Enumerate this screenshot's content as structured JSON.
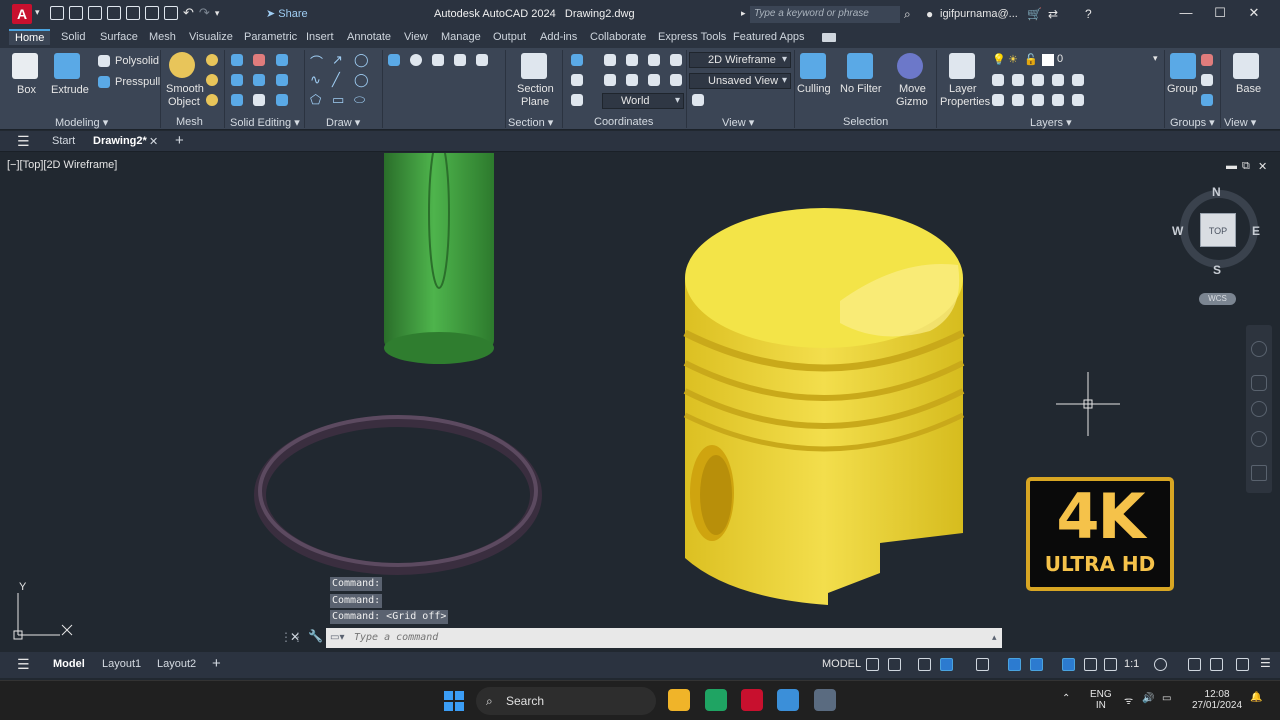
{
  "window": {
    "title": "Autodesk AutoCAD 2024",
    "file": "Drawing2.dwg",
    "share_label": "Share",
    "search_placeholder": "Type a keyword or phrase",
    "user": "igifpurnama@..."
  },
  "ribbon_tabs": [
    "Home",
    "Solid",
    "Surface",
    "Mesh",
    "Visualize",
    "Parametric",
    "Insert",
    "Annotate",
    "View",
    "Manage",
    "Output",
    "Add-ins",
    "Collaborate",
    "Express Tools",
    "Featured Apps"
  ],
  "ribbon": {
    "box": "Box",
    "extrude": "Extrude",
    "polysolid": "Polysolid",
    "presspull": "Presspull",
    "smooth_object_1": "Smooth",
    "smooth_object_2": "Object",
    "section_plane_1": "Section",
    "section_plane_2": "Plane",
    "visual_style": "2D Wireframe",
    "view_state": "Unsaved View",
    "ucs": "World",
    "culling": "Culling",
    "no_filter": "No Filter",
    "move_gizmo_1": "Move",
    "move_gizmo_2": "Gizmo",
    "layer_properties_1": "Layer",
    "layer_properties_2": "Properties",
    "layer_current": "0",
    "group": "Group",
    "base": "Base",
    "groups": {
      "modeling": "Modeling",
      "mesh": "Mesh",
      "solid_editing": "Solid Editing",
      "draw": "Draw",
      "section": "Section",
      "coordinates": "Coordinates",
      "view": "View",
      "selection": "Selection",
      "layers": "Layers",
      "groups": "Groups",
      "view2": "View"
    }
  },
  "file_tabs": {
    "start": "Start",
    "drawing": "Drawing2*"
  },
  "viewport": {
    "label": "[−][Top][2D Wireframe]",
    "viewcube": {
      "n": "N",
      "s": "S",
      "e": "E",
      "w": "W",
      "top": "TOP",
      "wcs": "WCS"
    },
    "ucs_y": "Y",
    "colors": {
      "pin": "#3f9a3c",
      "piston": "#e8d23a",
      "ring": "#4b3b4f"
    }
  },
  "badge": {
    "main": "4K",
    "sub": "ULTRA HD"
  },
  "command_history": [
    "Command:",
    "Command:",
    "Command:  <Grid off>"
  ],
  "command_input_placeholder": "Type a command",
  "layout_tabs": [
    "Model",
    "Layout1",
    "Layout2"
  ],
  "status": {
    "model": "MODEL",
    "scale": "1:1"
  },
  "taskbar": {
    "search": "Search",
    "lang_1": "ENG",
    "lang_2": "IN",
    "time": "12:08",
    "date": "27/01/2024"
  }
}
